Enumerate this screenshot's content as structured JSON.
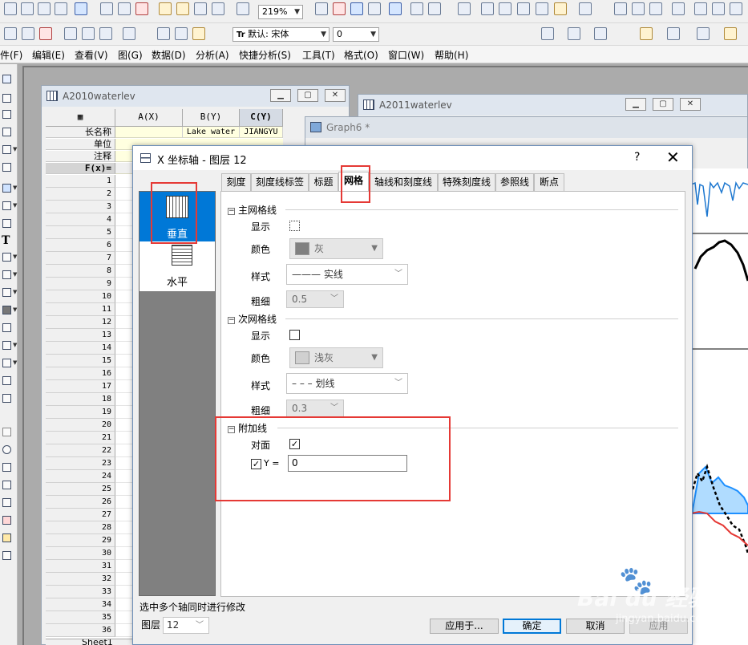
{
  "toolbar": {
    "zoom": "219%",
    "font_name": "默认: 宋体",
    "font_size": "0"
  },
  "menubar": [
    "件(F)",
    "编辑(E)",
    "查看(V)",
    "图(G)",
    "数据(D)",
    "分析(A)",
    "快捷分析(S)",
    "工具(T)",
    "格式(O)",
    "窗口(W)",
    "帮助(H)"
  ],
  "windows": {
    "workbook_title": "A2010waterlev",
    "workbook2_title": "A2011waterlev",
    "graph_title": "Graph6 *"
  },
  "sheet": {
    "columns": [
      "A(X)",
      "B(Y)",
      "C(Y)"
    ],
    "meta_labels": [
      "长名称",
      "单位",
      "注释",
      "F(x)="
    ],
    "long_names": [
      "",
      "Lake water",
      "JIANGYU"
    ],
    "rows": [
      "1",
      "2",
      "3",
      "4",
      "5",
      "6",
      "7",
      "8",
      "9",
      "10",
      "11",
      "12",
      "13",
      "14",
      "15",
      "16",
      "17",
      "18",
      "19",
      "20",
      "21",
      "22",
      "23",
      "24",
      "25",
      "26",
      "27",
      "28",
      "29",
      "30",
      "31",
      "32",
      "33",
      "34",
      "35",
      "36"
    ],
    "sheet_tab": "Sheet1"
  },
  "dialog": {
    "title": "X 坐标轴 - 图层 12",
    "help": "?",
    "close": "✕",
    "axis_items": [
      "垂直",
      "水平"
    ],
    "tabs": [
      "刻度",
      "刻度线标签",
      "标题",
      "网格",
      "轴线和刻度线",
      "特殊刻度线",
      "参照线",
      "断点"
    ],
    "active_tab": "网格",
    "major": {
      "group": "主网格线",
      "show_label": "显示",
      "color_label": "颜色",
      "color_value": "灰",
      "style_label": "样式",
      "style_value": "——— 实线",
      "thickness_label": "粗细",
      "thickness_value": "0.5"
    },
    "minor": {
      "group": "次网格线",
      "show_label": "显示",
      "color_label": "颜色",
      "color_value": "浅灰",
      "style_label": "样式",
      "style_value": "– – – 划线",
      "thickness_label": "粗细",
      "thickness_value": "0.3"
    },
    "additional": {
      "group": "附加线",
      "opposite_label": "对面",
      "opposite_checked": true,
      "y_label": "Y =",
      "y_checked": true,
      "y_value": "0"
    },
    "footer_note": "选中多个轴同时进行修改",
    "layer_label": "图层",
    "layer_value": "12",
    "buttons": {
      "apply_to": "应用于...",
      "ok": "确定",
      "cancel": "取消",
      "apply": "应用"
    }
  },
  "watermark": {
    "brand": "Bai du 经验",
    "url": "jingyan.baidu.com"
  },
  "colors": {
    "highlight": "#e53935",
    "selection": "#0078d7",
    "graph_blue": "#1e90ff",
    "graph_red": "#e53935"
  }
}
